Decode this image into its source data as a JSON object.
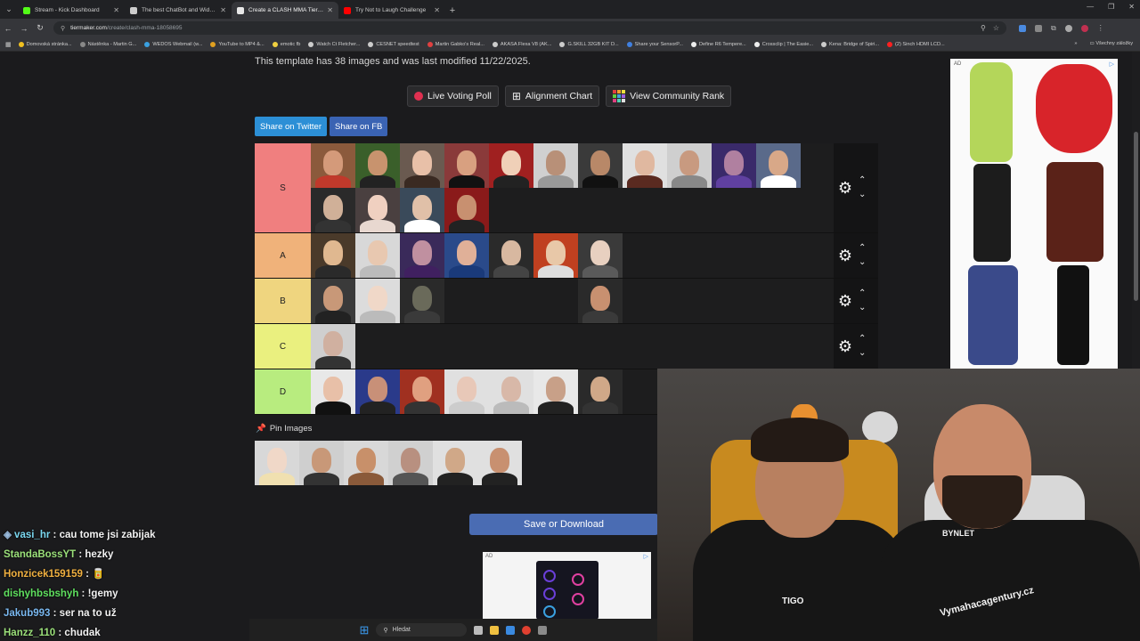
{
  "browser": {
    "tabs": [
      {
        "title": "Stream - Kick Dashboard",
        "favicon_color": "#53fc18",
        "active": false
      },
      {
        "title": "The best ChatBot and Widgets",
        "favicon_color": "#cccccc",
        "active": false
      },
      {
        "title": "Create a CLASH MMA Tier List",
        "favicon_color": "#e8e8e8",
        "active": true
      },
      {
        "title": "Try Not to Laugh Challenge",
        "favicon_color": "#ff0000",
        "active": false
      }
    ],
    "url_host": "tiermaker.com",
    "url_path": "/create/clash-mma-18058695",
    "bookmarks": [
      {
        "label": "Domovská stránka...",
        "color": "#f0c020"
      },
      {
        "label": "Nástěnka - Martin G...",
        "color": "#888888"
      },
      {
        "label": "WEDOS Webmail (w...",
        "color": "#3aa0e0"
      },
      {
        "label": "YouTube to MP4 &...",
        "color": "#e0a020"
      },
      {
        "label": "emotic fb",
        "color": "#f0d040"
      },
      {
        "label": "Watch Ct Fletcher...",
        "color": "#cccccc"
      },
      {
        "label": "CESNET speedtest",
        "color": "#cccccc"
      },
      {
        "label": "Martin Gabko's Real...",
        "color": "#e04040"
      },
      {
        "label": "AKASA Flexa V8 (AK...",
        "color": "#cccccc"
      },
      {
        "label": "G.SKILL 32GB KIT D...",
        "color": "#cccccc"
      },
      {
        "label": "Share your SensorP...",
        "color": "#4080e0"
      },
      {
        "label": "Define R6 Tempere...",
        "color": "#eeeeee"
      },
      {
        "label": "Crossclip | The Easie...",
        "color": "#eeeeee"
      },
      {
        "label": "Kena: Bridge of Spiri...",
        "color": "#cccccc"
      },
      {
        "label": "(2) Sinch HDMI LCD...",
        "color": "#ff2020"
      }
    ],
    "bookmarks_other": "Všechny záložky"
  },
  "page": {
    "template_info": "This template has 38 images and was last modified 11/22/2025.",
    "buttons": {
      "live_voting": "Live Voting Poll",
      "alignment": "Alignment Chart",
      "community_rank": "View Community Rank"
    },
    "share": {
      "twitter": "Share on Twitter",
      "fb": "Share on FB"
    },
    "tiers": [
      {
        "label": "S",
        "color": "#f07f7f",
        "rows": 2,
        "items": [
          {
            "bg": "#8b5a3c",
            "skin": "#d49a7a",
            "shirt": "#c0392b"
          },
          {
            "bg": "#3a5f2a",
            "skin": "#c8936e",
            "shirt": "#222222"
          },
          {
            "bg": "#6a5a50",
            "skin": "#e8c0a8",
            "shirt": "#3a2a22"
          },
          {
            "bg": "#8a3a3a",
            "skin": "#d8a080",
            "shirt": "#111111"
          },
          {
            "bg": "#a02020",
            "skin": "#f0d0b8",
            "shirt": "#222222"
          },
          {
            "bg": "#d0d0d0",
            "skin": "#b89078",
            "shirt": "#999999"
          },
          {
            "bg": "#3a3a3a",
            "skin": "#b88868",
            "shirt": "#111111"
          },
          {
            "bg": "#e0e0e0",
            "skin": "#e0b8a0",
            "shirt": "#5a2a20"
          },
          {
            "bg": "#cfcfcf",
            "skin": "#c89a80",
            "shirt": "#888888"
          },
          {
            "bg": "#3a2a6a",
            "skin": "#b080a0",
            "shirt": "#6040a0"
          },
          {
            "bg": "#5a6a8a",
            "skin": "#d8a888",
            "shirt": "#ffffff"
          },
          {
            "bg": "#2a2a2a",
            "skin": "#d0b098",
            "shirt": "#333333"
          },
          {
            "bg": "#4a4040",
            "skin": "#f0d0c0",
            "shirt": "#e8d8d0"
          },
          {
            "bg": "#3a4a5a",
            "skin": "#e0c0a8",
            "shirt": "#ffffff"
          },
          {
            "bg": "#8a1a1a",
            "skin": "#c89070",
            "shirt": "#222222"
          }
        ]
      },
      {
        "label": "A",
        "color": "#f0b27a",
        "rows": 1,
        "items": [
          {
            "bg": "#4a3a2a",
            "skin": "#e0b890",
            "shirt": "#2a2a2a"
          },
          {
            "bg": "#d8d8d8",
            "skin": "#e8c8b0",
            "shirt": "#bbbbbb"
          },
          {
            "bg": "#3a2a5a",
            "skin": "#c090a0",
            "shirt": "#402060"
          },
          {
            "bg": "#2a4a8a",
            "skin": "#e0b098",
            "shirt": "#1a3a7a"
          },
          {
            "bg": "#2a2a2a",
            "skin": "#d8b8a0",
            "shirt": "#444444"
          },
          {
            "bg": "#c04020",
            "skin": "#e8c8a8",
            "shirt": "#dddddd"
          },
          {
            "bg": "#3a3a3a",
            "skin": "#e8d0c0",
            "shirt": "#5a5a5a"
          }
        ]
      },
      {
        "label": "B",
        "color": "#efd57f",
        "rows": 1,
        "items": [
          {
            "bg": "#3a3a3a",
            "skin": "#c89878",
            "shirt": "#222222"
          },
          {
            "bg": "#dcdcdc",
            "skin": "#f0d8c8",
            "shirt": "#bbbbbb"
          },
          {
            "bg": "#2a2a2a",
            "skin": "#6a6a5a",
            "shirt": "#3a3a3a"
          },
          {
            "bg": "#1d1d1e",
            "skin": "#1d1d1e",
            "shirt": "#1d1d1e"
          },
          {
            "bg": "#1d1d1e",
            "skin": "#1d1d1e",
            "shirt": "#1d1d1e"
          },
          {
            "bg": "#1d1d1e",
            "skin": "#1d1d1e",
            "shirt": "#1d1d1e"
          },
          {
            "bg": "#2a2a2a",
            "skin": "#c89070",
            "shirt": "#3a3a3a"
          }
        ]
      },
      {
        "label": "C",
        "color": "#eaf07f",
        "rows": 1,
        "items": [
          {
            "bg": "#cfcfcf",
            "skin": "#d0b0a0",
            "shirt": "#333333"
          }
        ]
      },
      {
        "label": "D",
        "color": "#b8ec7f",
        "rows": 1,
        "items": [
          {
            "bg": "#e8e8e8",
            "skin": "#e8c0a8",
            "shirt": "#111111"
          },
          {
            "bg": "#2a3a8a",
            "skin": "#c89078",
            "shirt": "#222222"
          },
          {
            "bg": "#a03020",
            "skin": "#e0a080",
            "shirt": "#333333"
          },
          {
            "bg": "#e0e0e0",
            "skin": "#e8c8b8",
            "shirt": "#cccccc"
          },
          {
            "bg": "#e0e0e0",
            "skin": "#d8b8a8",
            "shirt": "#bbbbbb"
          },
          {
            "bg": "#e8e8e8",
            "skin": "#c8a088",
            "shirt": "#222222"
          },
          {
            "bg": "#2a2a2a",
            "skin": "#d0a888",
            "shirt": "#333333"
          }
        ]
      }
    ],
    "pin_images_label": "Pin Images",
    "pin_items": [
      {
        "bg": "#d8d8d8",
        "skin": "#f0d8c8",
        "shirt": "#f0e0b0"
      },
      {
        "bg": "#cfcfcf",
        "skin": "#c89878",
        "shirt": "#333333"
      },
      {
        "bg": "#d8d8d8",
        "skin": "#c8906a",
        "shirt": "#8a5a3a"
      },
      {
        "bg": "#d0d0d0",
        "skin": "#b89080",
        "shirt": "#555555"
      },
      {
        "bg": "#e0e0e0",
        "skin": "#d0a888",
        "shirt": "#222222"
      },
      {
        "bg": "#e0e0e0",
        "skin": "#c89070",
        "shirt": "#222222"
      }
    ],
    "save_label": "Save or Download",
    "ad_label": "AD",
    "ad_info": "▷"
  },
  "chat": [
    {
      "user": "vasi_hr",
      "color": "#7ad8f0",
      "msg": "cau tome jsi zabijak",
      "badge": true
    },
    {
      "user": "StandaBossYT",
      "color": "#9be07a",
      "msg": "hezky"
    },
    {
      "user": "Honzicek159159",
      "color": "#f0b040",
      "msg": "🥫"
    },
    {
      "user": "dishyhbsbshyh",
      "color": "#5fe05f",
      "msg": "!gemy"
    },
    {
      "user": "Jakub993",
      "color": "#7ab8f0",
      "msg": "ser na to už"
    },
    {
      "user": "Hanzz_110",
      "color": "#9be07a",
      "msg": "chudak"
    }
  ],
  "webcam": {
    "shirt_logo_left": "TIGO",
    "shirt_logo_right": "Vymahacagentury.cz",
    "shirt_text_top": "BYNLET"
  },
  "taskbar": {
    "search_label": "Hledat"
  }
}
